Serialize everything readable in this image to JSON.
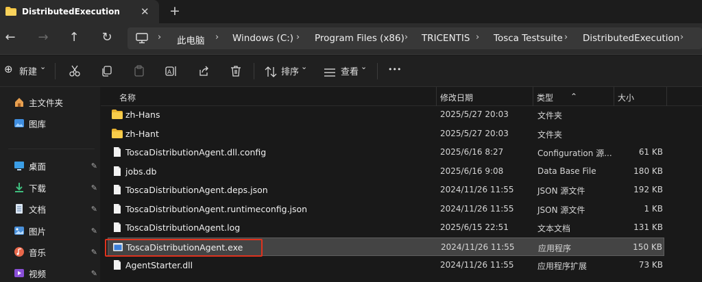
{
  "tab": {
    "title": "DistributedExecution",
    "close": "✕",
    "new_tab": "+"
  },
  "nav": {
    "back": "←",
    "forward": "→",
    "up": "↑",
    "refresh": "↻"
  },
  "breadcrumbs": [
    "此电脑",
    "Windows (C:)",
    "Program Files (x86)",
    "TRICENTIS",
    "Tosca Testsuite",
    "DistributedExecution"
  ],
  "breadcrumb_separator": "›",
  "toolbar": {
    "new_label": "新建",
    "sort_label": "排序",
    "view_label": "查看",
    "more": "•••",
    "new_icon": "⊕",
    "chevron": "⌄"
  },
  "sidebar": {
    "items": [
      {
        "label": "主文件夹",
        "icon": "home-icon",
        "pinned": false
      },
      {
        "label": "图库",
        "icon": "gallery-icon",
        "pinned": false
      },
      {
        "label": "桌面",
        "icon": "desktop-icon",
        "pinned": true
      },
      {
        "label": "下载",
        "icon": "download-icon",
        "pinned": true
      },
      {
        "label": "文档",
        "icon": "documents-icon",
        "pinned": true
      },
      {
        "label": "图片",
        "icon": "pictures-icon",
        "pinned": true
      },
      {
        "label": "音乐",
        "icon": "music-icon",
        "pinned": true
      },
      {
        "label": "视频",
        "icon": "videos-icon",
        "pinned": true
      }
    ],
    "pin_glyph": "📌"
  },
  "columns": {
    "name": "名称",
    "modified": "修改日期",
    "type": "类型",
    "size": "大小"
  },
  "files": [
    {
      "name": "zh-Hans",
      "modified": "2025/5/27 20:03",
      "type": "文件夹",
      "size": "",
      "kind": "folder"
    },
    {
      "name": "zh-Hant",
      "modified": "2025/5/27 20:03",
      "type": "文件夹",
      "size": "",
      "kind": "folder"
    },
    {
      "name": "ToscaDistributionAgent.dll.config",
      "modified": "2025/6/16 8:27",
      "type": "Configuration 源...",
      "size": "61 KB",
      "kind": "doc"
    },
    {
      "name": "jobs.db",
      "modified": "2025/6/16 9:08",
      "type": "Data Base File",
      "size": "180 KB",
      "kind": "doc"
    },
    {
      "name": "ToscaDistributionAgent.deps.json",
      "modified": "2024/11/26 11:55",
      "type": "JSON 源文件",
      "size": "192 KB",
      "kind": "doc"
    },
    {
      "name": "ToscaDistributionAgent.runtimeconfig.json",
      "modified": "2024/11/26 11:55",
      "type": "JSON 源文件",
      "size": "1 KB",
      "kind": "doc"
    },
    {
      "name": "ToscaDistributionAgent.log",
      "modified": "2025/6/15 22:51",
      "type": "文本文档",
      "size": "131 KB",
      "kind": "doc"
    },
    {
      "name": "ToscaDistributionAgent.exe",
      "modified": "2024/11/26 11:55",
      "type": "应用程序",
      "size": "150 KB",
      "kind": "exe",
      "selected": true
    },
    {
      "name": "AgentStarter.dll",
      "modified": "2024/11/26 11:55",
      "type": "应用程序扩展",
      "size": "73 KB",
      "kind": "doc"
    }
  ],
  "colors": {
    "highlight": "#e0331e",
    "selected_row": "#444444",
    "folder": "#f5c542"
  }
}
